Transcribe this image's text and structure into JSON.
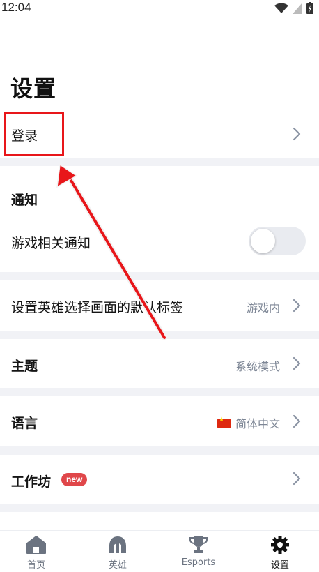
{
  "status_bar": {
    "time": "12:04"
  },
  "page": {
    "title": "设置"
  },
  "login": {
    "label": "登录"
  },
  "notifications": {
    "section_title": "通知",
    "game_notify_label": "游戏相关通知",
    "game_notify_enabled": false
  },
  "champ_select": {
    "label": "设置英雄选择画面的默认标签",
    "value": "游戏内"
  },
  "theme": {
    "label": "主题",
    "value": "系统模式"
  },
  "language": {
    "label": "语言",
    "value": "简体中文"
  },
  "workshop": {
    "label": "工作坊",
    "badge": "new"
  },
  "bottom_nav": {
    "items": [
      {
        "label": "首页",
        "icon": "home-icon"
      },
      {
        "label": "英雄",
        "icon": "champion-helmet-icon"
      },
      {
        "label": "Esports",
        "icon": "trophy-icon"
      },
      {
        "label": "设置",
        "icon": "gear-icon",
        "active": true
      }
    ]
  },
  "colors": {
    "accent_red": "#e8161a",
    "badge_red": "#e0474a",
    "divider": "#f1f2f6",
    "muted_text": "#7d8695"
  }
}
